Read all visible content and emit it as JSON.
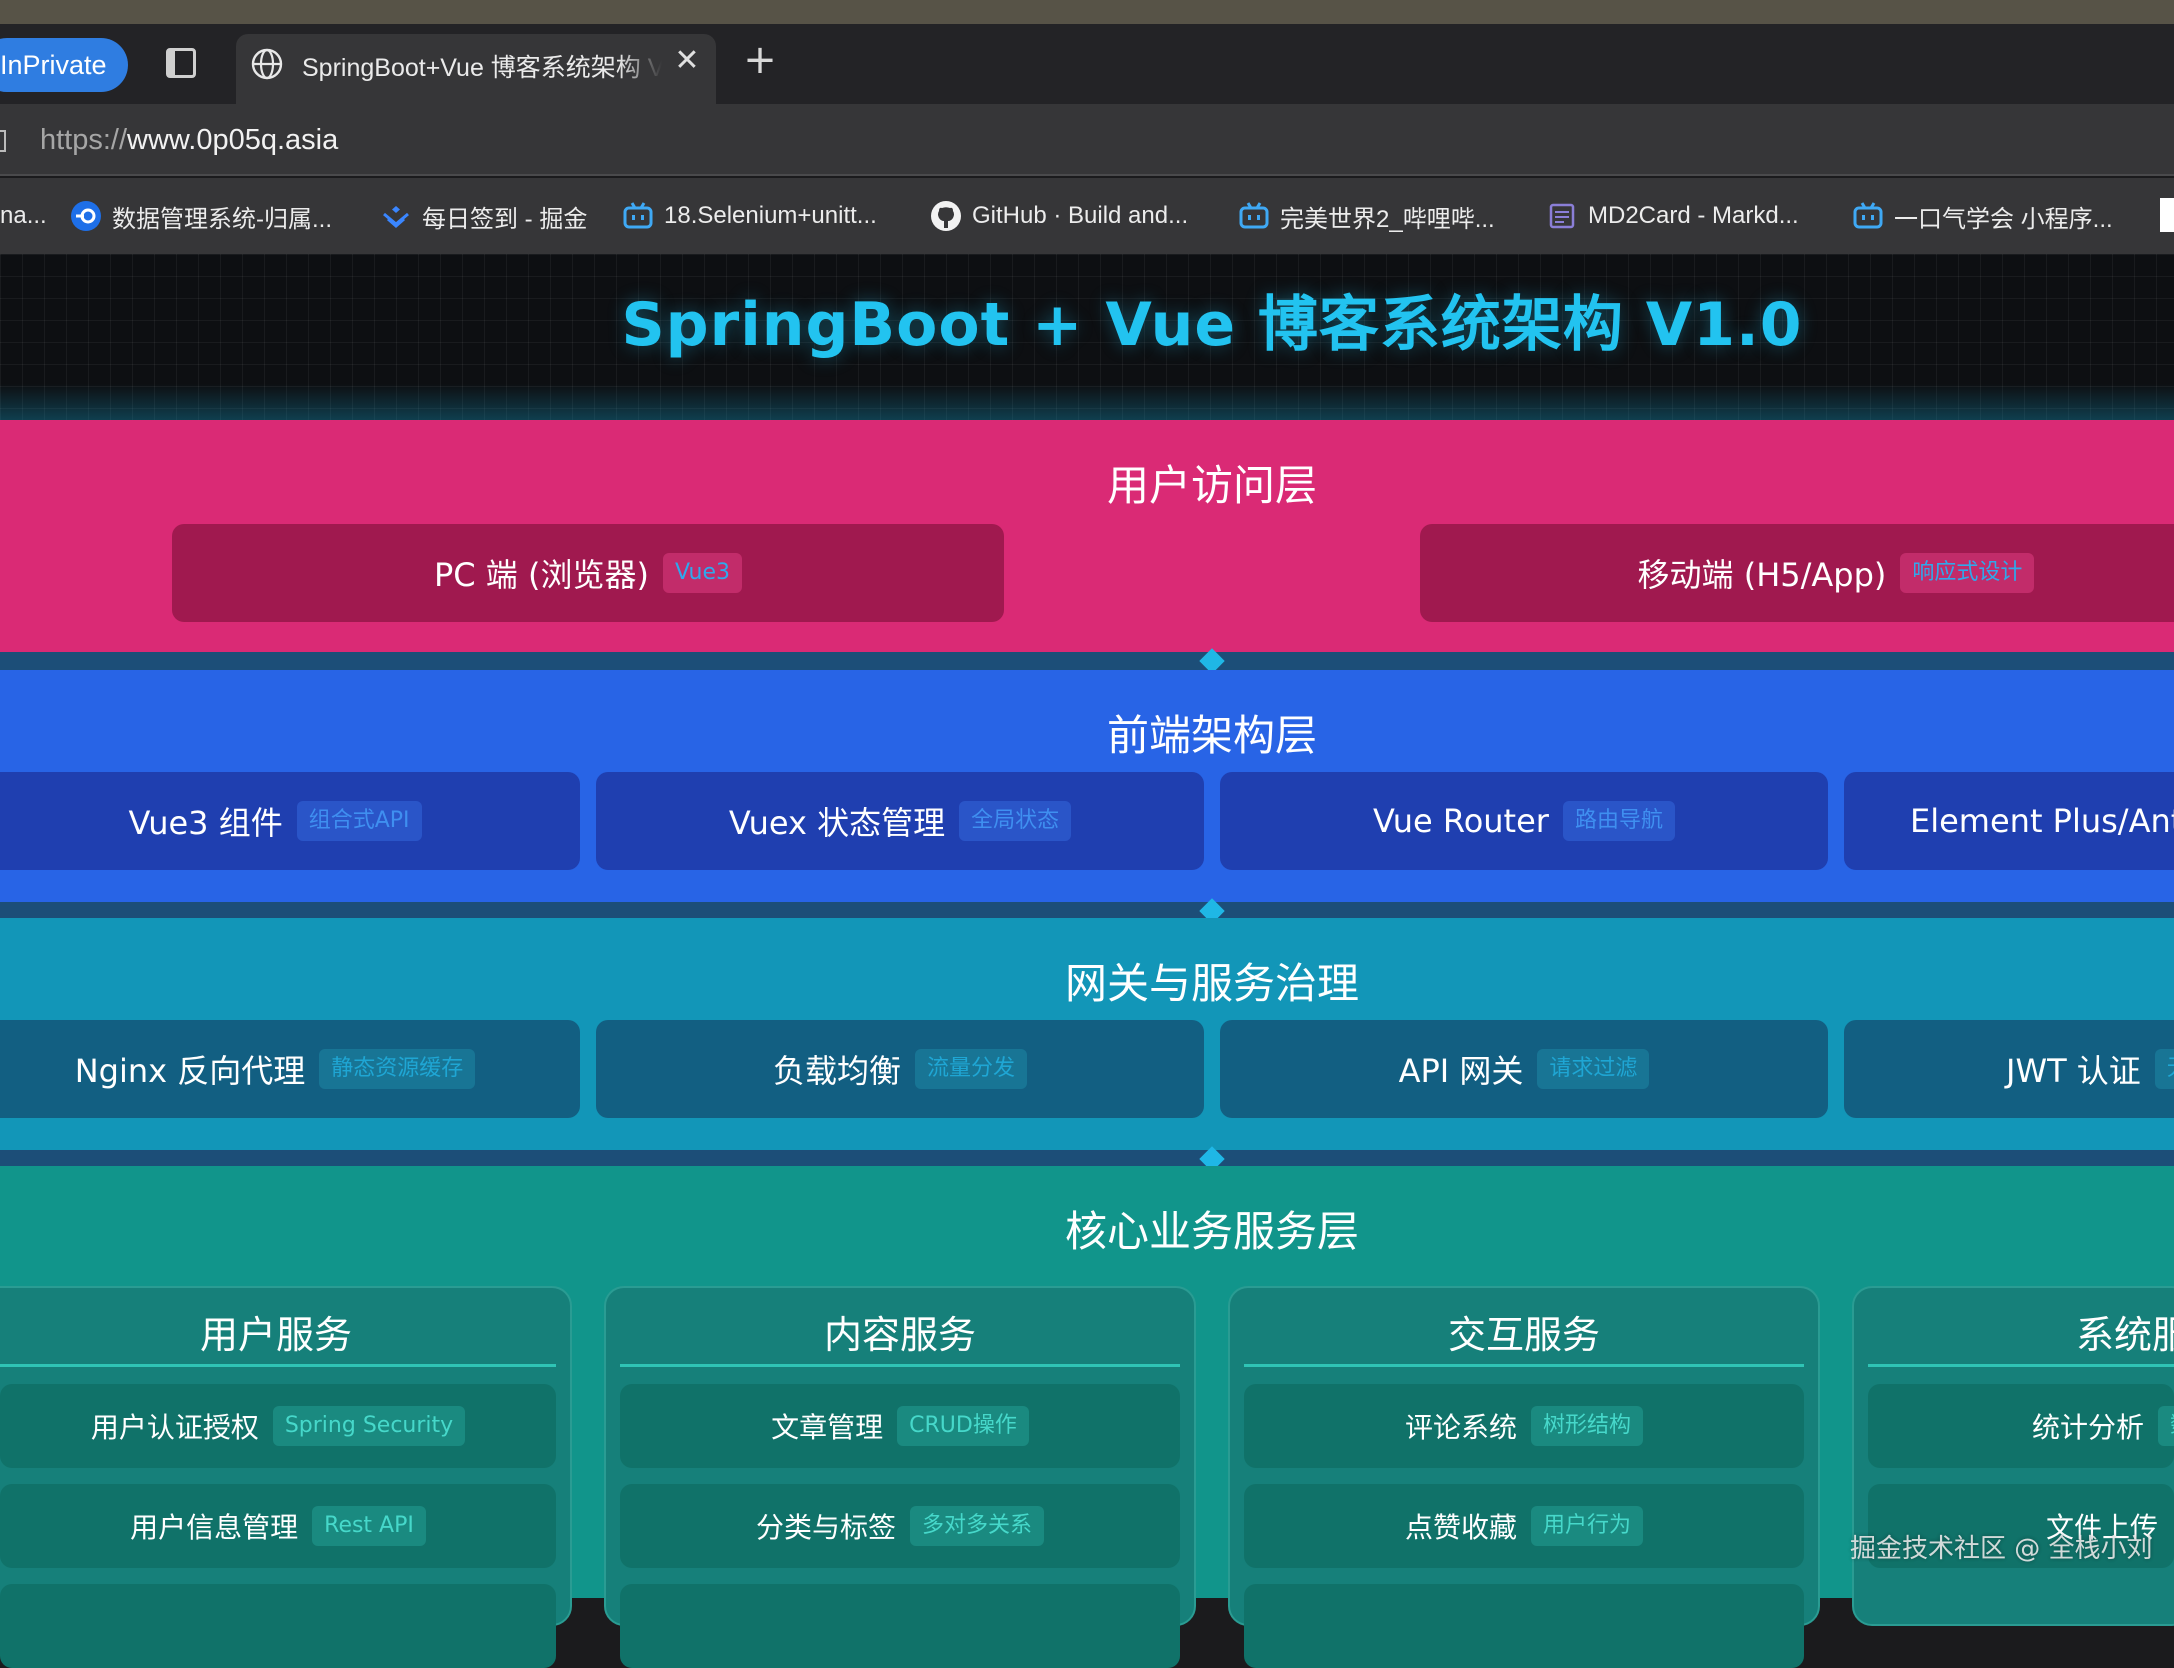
{
  "browser": {
    "private_badge": "InPrivate",
    "tab": {
      "title": "SpringBoot+Vue 博客系统架构 V",
      "close": "✕"
    },
    "new_tab": "+",
    "url": {
      "protocol": "https://",
      "host": "www.0p05q.asia"
    },
    "favorites": [
      {
        "label": "na...",
        "icon": "page-icon"
      },
      {
        "label": "数据管理系统-归属...",
        "icon": "blue-link-icon"
      },
      {
        "label": "每日签到 - 掘金",
        "icon": "juejin-icon"
      },
      {
        "label": "18.Selenium+unitt...",
        "icon": "bilibili-icon"
      },
      {
        "label": "GitHub · Build and...",
        "icon": "github-icon"
      },
      {
        "label": "完美世界2_哔哩哔...",
        "icon": "bilibili-icon"
      },
      {
        "label": "MD2Card - Markd...",
        "icon": "md2card-icon"
      },
      {
        "label": "一口气学会 小程序...",
        "icon": "bilibili-icon"
      }
    ]
  },
  "page": {
    "title": "SpringBoot + Vue 博客系统架构 V1.0",
    "colors": {
      "title": "#22c3f0",
      "user_layer": "#da2a75",
      "frontend_layer": "#2864e6",
      "gateway_layer": "#1296b8",
      "core_layer": "#11958b"
    },
    "user_layer": {
      "title": "用户访问层",
      "items": [
        {
          "label": "PC 端 (浏览器)",
          "tag": "Vue3"
        },
        {
          "label": "移动端 (H5/App)",
          "tag": "响应式设计"
        }
      ]
    },
    "frontend_layer": {
      "title": "前端架构层",
      "items": [
        {
          "label": "Vue3 组件",
          "tag": "组合式API"
        },
        {
          "label": "Vuex 状态管理",
          "tag": "全局状态"
        },
        {
          "label": "Vue Router",
          "tag": "路由导航"
        },
        {
          "label": "Element Plus/Ant D",
          "tag": ""
        }
      ]
    },
    "gateway_layer": {
      "title": "网关与服务治理",
      "items": [
        {
          "label": "Nginx 反向代理",
          "tag": "静态资源缓存"
        },
        {
          "label": "负载均衡",
          "tag": "流量分发"
        },
        {
          "label": "API 网关",
          "tag": "请求过滤"
        },
        {
          "label": "JWT 认证",
          "tag": "无"
        }
      ]
    },
    "core_layer": {
      "title": "核心业务服务层",
      "services": [
        {
          "title": "用户服务",
          "items": [
            {
              "label": "用户认证授权",
              "tag": "Spring Security"
            },
            {
              "label": "用户信息管理",
              "tag": "Rest API"
            }
          ]
        },
        {
          "title": "内容服务",
          "items": [
            {
              "label": "文章管理",
              "tag": "CRUD操作"
            },
            {
              "label": "分类与标签",
              "tag": "多对多关系"
            }
          ]
        },
        {
          "title": "交互服务",
          "items": [
            {
              "label": "评论系统",
              "tag": "树形结构"
            },
            {
              "label": "点赞收藏",
              "tag": "用户行为"
            }
          ]
        },
        {
          "title": "系统服",
          "items": [
            {
              "label": "统计分析",
              "tag": "数"
            },
            {
              "label": "文件上传",
              "tag": ""
            }
          ]
        }
      ]
    },
    "watermark": "掘金技术社区 @ 全栈小刘"
  }
}
